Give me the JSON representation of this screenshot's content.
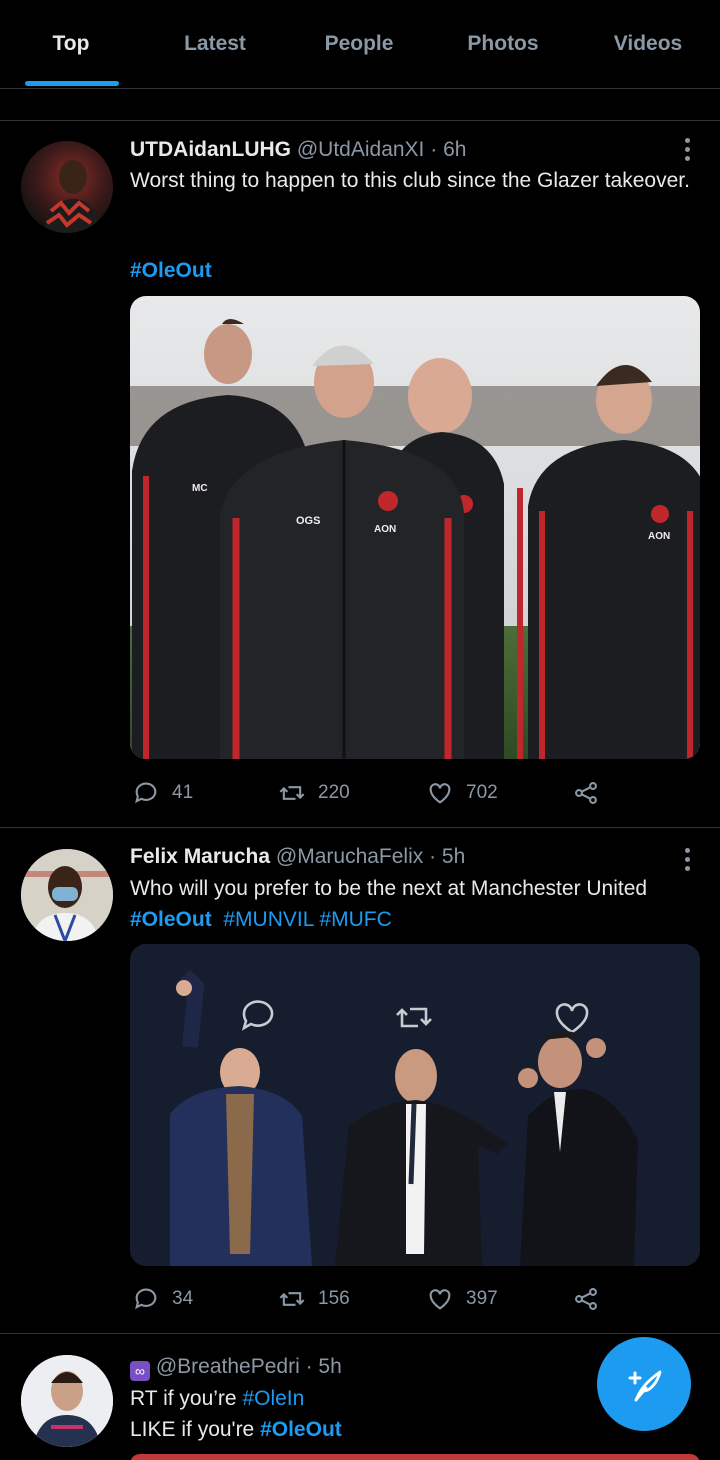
{
  "tabs": [
    {
      "label": "Top",
      "active": true
    },
    {
      "label": "Latest",
      "active": false
    },
    {
      "label": "People",
      "active": false
    },
    {
      "label": "Photos",
      "active": false
    },
    {
      "label": "Videos",
      "active": false
    }
  ],
  "colors": {
    "accent": "#1d9bf0",
    "muted": "#8b98a5",
    "text": "#e7e9ea",
    "background": "#000000",
    "divider": "#2f3336"
  },
  "icons": {
    "reply": "reply-icon",
    "retweet": "retweet-icon",
    "like": "heart-icon",
    "share": "share-icon",
    "more": "more-icon",
    "compose": "compose-tweet-icon"
  },
  "tweets": [
    {
      "name": "UTDAidanLUHG",
      "handle": "@UtdAidanXI",
      "time": "· 6h",
      "text": "Worst thing to happen to this club since the Glazer takeover.",
      "hashtag": "#OleOut",
      "media_badges": [
        "MC",
        "OGS",
        "AON"
      ],
      "replies": "41",
      "retweets": "220",
      "likes": "702"
    },
    {
      "name": "Felix Marucha",
      "handle": "@MaruchaFelix",
      "time": "· 5h",
      "text": "Who will you prefer to be the next at Manchester United",
      "hashtags": [
        "#OleOut",
        "#MUNVIL",
        "#MUFC"
      ],
      "replies": "34",
      "retweets": "156",
      "likes": "397"
    },
    {
      "handle": "@BreathePedri",
      "time": "· 5h",
      "line1_prefix": "RT if you’re ",
      "line1_tag": "#OleIn",
      "line2_prefix": "LIKE if you're ",
      "line2_tag": "#OleOut"
    }
  ]
}
